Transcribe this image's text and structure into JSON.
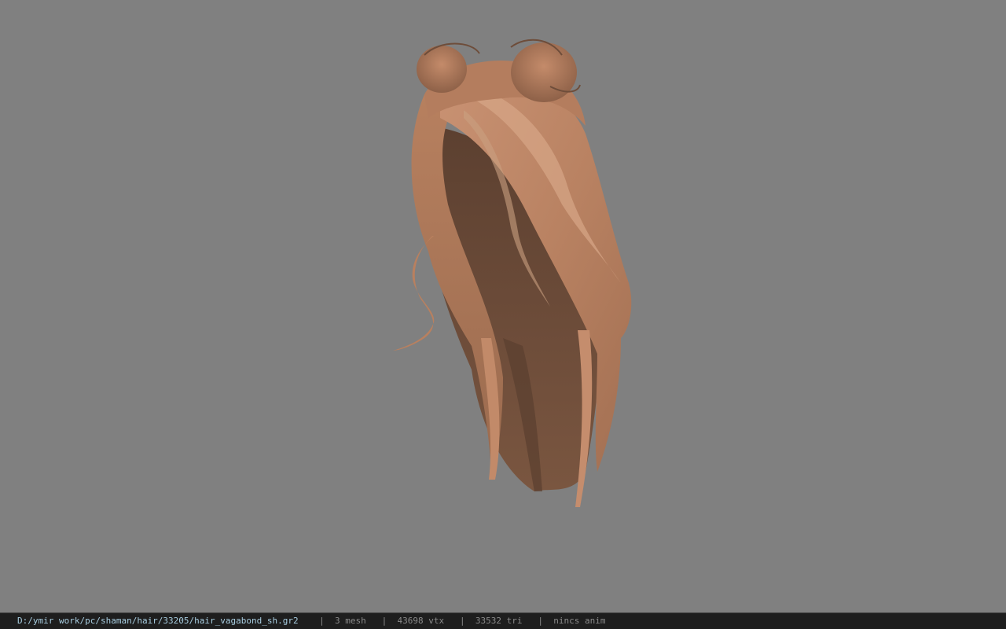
{
  "viewport": {
    "background_color": "#808080",
    "model_name": "hair_vagabond_sh",
    "hair_colors": [
      "#c68e6e",
      "#a6765a",
      "#6e4d3a",
      "#d7a688",
      "#4a3426"
    ]
  },
  "status_bar": {
    "file_path": "D:/ymir work/pc/shaman/hair/33205/hair_vagabond_sh.gr2",
    "separator": "|",
    "mesh_count": "3 mesh",
    "vertex_count": "43698 vtx",
    "triangle_count": "33532 tri",
    "anim_status": "nincs anim"
  }
}
